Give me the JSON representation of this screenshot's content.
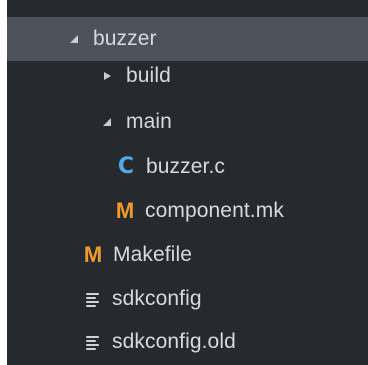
{
  "tree": {
    "items": [
      {
        "label": "buzzer",
        "type": "folder",
        "expanded": true,
        "selected": true,
        "icon": "expanded-triangle-icon"
      },
      {
        "label": "build",
        "type": "folder",
        "expanded": false,
        "selected": false,
        "icon": "collapsed-triangle-icon"
      },
      {
        "label": "main",
        "type": "folder",
        "expanded": true,
        "selected": false,
        "icon": "expanded-triangle-icon"
      },
      {
        "label": "buzzer.c",
        "type": "file",
        "selected": false,
        "icon": "c-file-icon",
        "icon_glyph": "C",
        "icon_color": "#53a9e8"
      },
      {
        "label": "component.mk",
        "type": "file",
        "selected": false,
        "icon": "makefile-icon",
        "icon_glyph": "M",
        "icon_color": "#f19a2c"
      },
      {
        "label": "Makefile",
        "type": "file",
        "selected": false,
        "icon": "makefile-icon",
        "icon_glyph": "M",
        "icon_color": "#f19a2c"
      },
      {
        "label": "sdkconfig",
        "type": "file",
        "selected": false,
        "icon": "text-file-icon"
      },
      {
        "label": "sdkconfig.old",
        "type": "file",
        "selected": false,
        "icon": "text-file-icon"
      }
    ]
  },
  "colors": {
    "panel_background": "#26292e",
    "selected_row": "#4c515a",
    "text": "#d6d9de",
    "c_icon": "#53a9e8",
    "m_icon": "#f19a2c"
  }
}
